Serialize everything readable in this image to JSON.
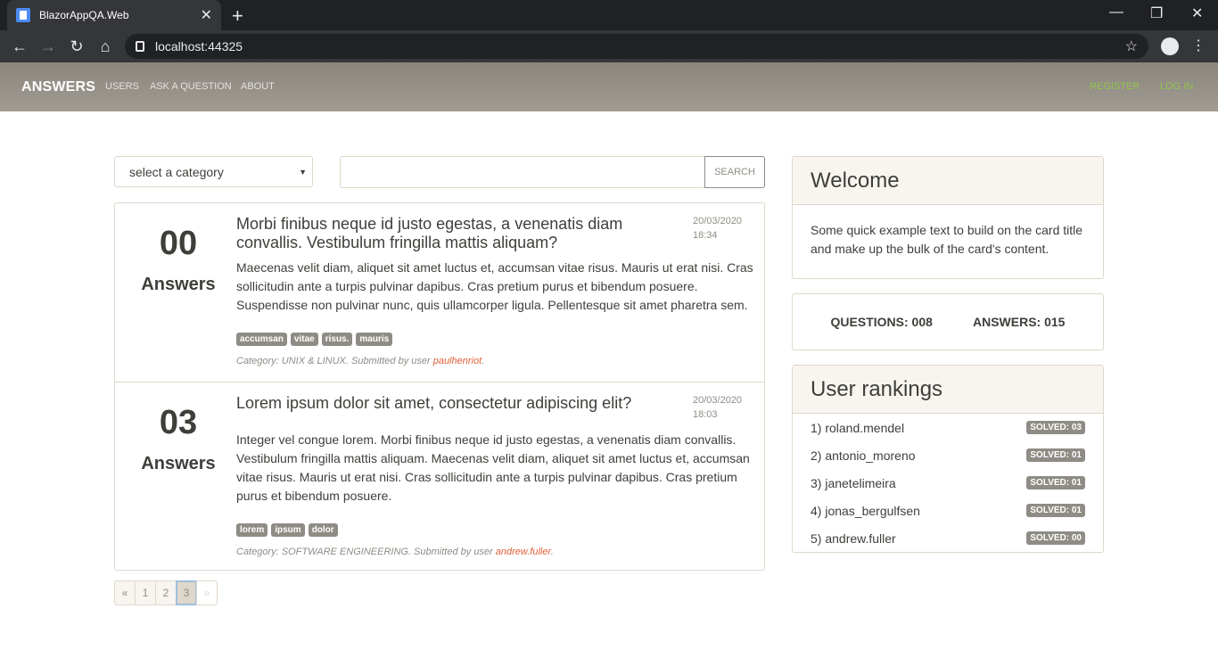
{
  "browser": {
    "tab_title": "BlazorAppQA.Web",
    "url": "localhost:44325"
  },
  "nav": {
    "brand": "ANSWERS",
    "links": [
      "USERS",
      "ASK A QUESTION",
      "ABOUT"
    ],
    "register": "REGISTER",
    "login": "LOG IN"
  },
  "search": {
    "category_placeholder": "select a category",
    "query": "",
    "button": "SEARCH"
  },
  "questions": [
    {
      "answers_count": "00",
      "answers_label": "Answers",
      "title": "Morbi finibus neque id justo egestas, a venenatis diam convallis. Vestibulum fringilla mattis aliquam?",
      "date": "20/03/2020",
      "time": "18:34",
      "body": "Maecenas velit diam, aliquet sit amet luctus et, accumsan vitae risus. Mauris ut erat nisi. Cras sollicitudin ante a turpis pulvinar dapibus. Cras pretium purus et bibendum posuere. Suspendisse non pulvinar nunc, quis ullamcorper ligula. Pellentesque sit amet pharetra sem.",
      "tags": [
        "accumsan",
        "vitae",
        "risus.",
        "mauris"
      ],
      "meta": "Category: UNIX & LINUX. Submitted by user ",
      "user": "paulhenriot",
      "meta_end": "."
    },
    {
      "answers_count": "03",
      "answers_label": "Answers",
      "title": "Lorem ipsum dolor sit amet, consectetur adipiscing elit?",
      "date": "20/03/2020",
      "time": "18:03",
      "body": "Integer vel congue lorem. Morbi finibus neque id justo egestas, a venenatis diam convallis. Vestibulum fringilla mattis aliquam. Maecenas velit diam, aliquet sit amet luctus et, accumsan vitae risus. Mauris ut erat nisi. Cras sollicitudin ante a turpis pulvinar dapibus. Cras pretium purus et bibendum posuere.",
      "tags": [
        "lorem",
        "ipsum",
        "dolor"
      ],
      "meta": "Category: SOFTWARE ENGINEERING. Submitted by user ",
      "user": "andrew.fuller",
      "meta_end": "."
    }
  ],
  "pager": {
    "prev": "«",
    "pages": [
      "1",
      "2",
      "3"
    ],
    "active": "3",
    "next": "»"
  },
  "welcome": {
    "title": "Welcome",
    "text": "Some quick example text to build on the card title and make up the bulk of the card's content."
  },
  "stats": {
    "questions": "QUESTIONS: 008",
    "answers": "ANSWERS: 015"
  },
  "rankings": {
    "title": "User rankings",
    "rows": [
      {
        "name": "1) roland.mendel",
        "solved": "SOLVED: 03"
      },
      {
        "name": "2) antonio_moreno",
        "solved": "SOLVED: 01"
      },
      {
        "name": "3) janetelimeira",
        "solved": "SOLVED: 01"
      },
      {
        "name": "4) jonas_bergulfsen",
        "solved": "SOLVED: 01"
      },
      {
        "name": "5) andrew.fuller",
        "solved": "SOLVED: 00"
      }
    ]
  }
}
